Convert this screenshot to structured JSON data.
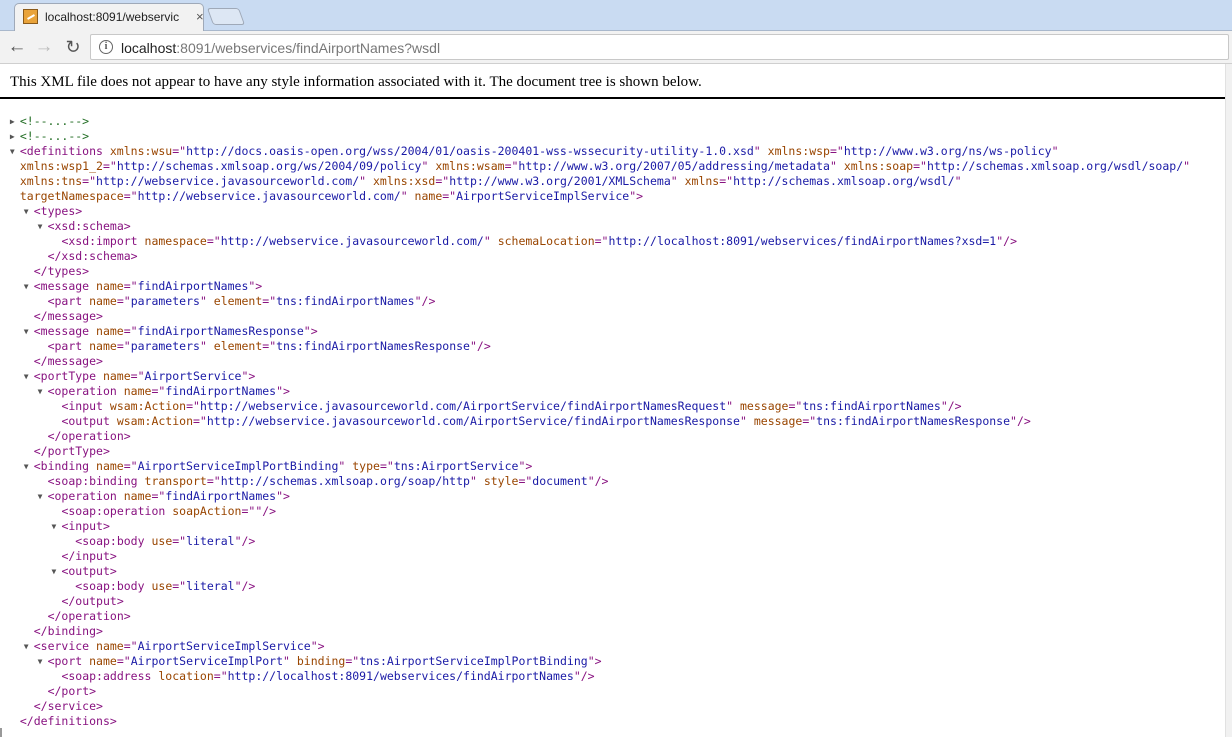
{
  "tab": {
    "title": "localhost:8091/webservic",
    "close": "×"
  },
  "toolbar": {
    "back": "←",
    "forward": "→",
    "reload": "↻"
  },
  "address": {
    "host": "localhost",
    "path": ":8091/webservices/findAirportNames?wsdl"
  },
  "notice": "This XML file does not appear to have any style information associated with it. The document tree is shown below.",
  "xml": [
    {
      "indent": 2,
      "tri": "right",
      "tokens": [
        {
          "k": "c",
          "t": "<!--...-->"
        }
      ]
    },
    {
      "indent": 2,
      "tri": "right",
      "tokens": [
        {
          "k": "c",
          "t": "<!--...-->"
        }
      ]
    },
    {
      "indent": 2,
      "tri": "down",
      "tokens": [
        {
          "k": "t",
          "t": "<definitions"
        },
        {
          "k": "a",
          "t": " xmlns:wsu"
        },
        {
          "k": "t",
          "t": "=\""
        },
        {
          "k": "v",
          "t": "http://docs.oasis-open.org/wss/2004/01/oasis-200401-wss-wssecurity-utility-1.0.xsd"
        },
        {
          "k": "t",
          "t": "\""
        },
        {
          "k": "a",
          "t": " xmlns:wsp"
        },
        {
          "k": "t",
          "t": "=\""
        },
        {
          "k": "v",
          "t": "http://www.w3.org/ns/ws-policy"
        },
        {
          "k": "t",
          "t": "\""
        }
      ]
    },
    {
      "indent": 2,
      "tokens": [
        {
          "k": "a",
          "t": "xmlns:wsp1_2"
        },
        {
          "k": "t",
          "t": "=\""
        },
        {
          "k": "v",
          "t": "http://schemas.xmlsoap.org/ws/2004/09/policy"
        },
        {
          "k": "t",
          "t": "\""
        },
        {
          "k": "a",
          "t": " xmlns:wsam"
        },
        {
          "k": "t",
          "t": "=\""
        },
        {
          "k": "v",
          "t": "http://www.w3.org/2007/05/addressing/metadata"
        },
        {
          "k": "t",
          "t": "\""
        },
        {
          "k": "a",
          "t": " xmlns:soap"
        },
        {
          "k": "t",
          "t": "=\""
        },
        {
          "k": "v",
          "t": "http://schemas.xmlsoap.org/wsdl/soap/"
        },
        {
          "k": "t",
          "t": "\""
        }
      ]
    },
    {
      "indent": 2,
      "tokens": [
        {
          "k": "a",
          "t": "xmlns:tns"
        },
        {
          "k": "t",
          "t": "=\""
        },
        {
          "k": "v",
          "t": "http://webservice.javasourceworld.com/"
        },
        {
          "k": "t",
          "t": "\""
        },
        {
          "k": "a",
          "t": " xmlns:xsd"
        },
        {
          "k": "t",
          "t": "=\""
        },
        {
          "k": "v",
          "t": "http://www.w3.org/2001/XMLSchema"
        },
        {
          "k": "t",
          "t": "\""
        },
        {
          "k": "a",
          "t": " xmlns"
        },
        {
          "k": "t",
          "t": "=\""
        },
        {
          "k": "v",
          "t": "http://schemas.xmlsoap.org/wsdl/"
        },
        {
          "k": "t",
          "t": "\""
        }
      ]
    },
    {
      "indent": 2,
      "tokens": [
        {
          "k": "a",
          "t": "targetNamespace"
        },
        {
          "k": "t",
          "t": "=\""
        },
        {
          "k": "v",
          "t": "http://webservice.javasourceworld.com/"
        },
        {
          "k": "t",
          "t": "\""
        },
        {
          "k": "a",
          "t": " name"
        },
        {
          "k": "t",
          "t": "=\""
        },
        {
          "k": "v",
          "t": "AirportServiceImplService"
        },
        {
          "k": "t",
          "t": "\">"
        }
      ]
    },
    {
      "indent": 4,
      "tri": "down",
      "tokens": [
        {
          "k": "t",
          "t": "<types>"
        }
      ]
    },
    {
      "indent": 6,
      "tri": "down",
      "tokens": [
        {
          "k": "t",
          "t": "<xsd:schema>"
        }
      ]
    },
    {
      "indent": 8,
      "tokens": [
        {
          "k": "t",
          "t": "<xsd:import"
        },
        {
          "k": "a",
          "t": " namespace"
        },
        {
          "k": "t",
          "t": "=\""
        },
        {
          "k": "v",
          "t": "http://webservice.javasourceworld.com/"
        },
        {
          "k": "t",
          "t": "\""
        },
        {
          "k": "a",
          "t": " schemaLocation"
        },
        {
          "k": "t",
          "t": "=\""
        },
        {
          "k": "v",
          "t": "http://localhost:8091/webservices/findAirportNames?xsd=1"
        },
        {
          "k": "t",
          "t": "\"/>"
        }
      ]
    },
    {
      "indent": 6,
      "tokens": [
        {
          "k": "t",
          "t": "</xsd:schema>"
        }
      ]
    },
    {
      "indent": 4,
      "tokens": [
        {
          "k": "t",
          "t": "</types>"
        }
      ]
    },
    {
      "indent": 4,
      "tri": "down",
      "tokens": [
        {
          "k": "t",
          "t": "<message"
        },
        {
          "k": "a",
          "t": " name"
        },
        {
          "k": "t",
          "t": "=\""
        },
        {
          "k": "v",
          "t": "findAirportNames"
        },
        {
          "k": "t",
          "t": "\">"
        }
      ]
    },
    {
      "indent": 6,
      "tokens": [
        {
          "k": "t",
          "t": "<part"
        },
        {
          "k": "a",
          "t": " name"
        },
        {
          "k": "t",
          "t": "=\""
        },
        {
          "k": "v",
          "t": "parameters"
        },
        {
          "k": "t",
          "t": "\""
        },
        {
          "k": "a",
          "t": " element"
        },
        {
          "k": "t",
          "t": "=\""
        },
        {
          "k": "v",
          "t": "tns:findAirportNames"
        },
        {
          "k": "t",
          "t": "\"/>"
        }
      ]
    },
    {
      "indent": 4,
      "tokens": [
        {
          "k": "t",
          "t": "</message>"
        }
      ]
    },
    {
      "indent": 4,
      "tri": "down",
      "tokens": [
        {
          "k": "t",
          "t": "<message"
        },
        {
          "k": "a",
          "t": " name"
        },
        {
          "k": "t",
          "t": "=\""
        },
        {
          "k": "v",
          "t": "findAirportNamesResponse"
        },
        {
          "k": "t",
          "t": "\">"
        }
      ]
    },
    {
      "indent": 6,
      "tokens": [
        {
          "k": "t",
          "t": "<part"
        },
        {
          "k": "a",
          "t": " name"
        },
        {
          "k": "t",
          "t": "=\""
        },
        {
          "k": "v",
          "t": "parameters"
        },
        {
          "k": "t",
          "t": "\""
        },
        {
          "k": "a",
          "t": " element"
        },
        {
          "k": "t",
          "t": "=\""
        },
        {
          "k": "v",
          "t": "tns:findAirportNamesResponse"
        },
        {
          "k": "t",
          "t": "\"/>"
        }
      ]
    },
    {
      "indent": 4,
      "tokens": [
        {
          "k": "t",
          "t": "</message>"
        }
      ]
    },
    {
      "indent": 4,
      "tri": "down",
      "tokens": [
        {
          "k": "t",
          "t": "<portType"
        },
        {
          "k": "a",
          "t": " name"
        },
        {
          "k": "t",
          "t": "=\""
        },
        {
          "k": "v",
          "t": "AirportService"
        },
        {
          "k": "t",
          "t": "\">"
        }
      ]
    },
    {
      "indent": 6,
      "tri": "down",
      "tokens": [
        {
          "k": "t",
          "t": "<operation"
        },
        {
          "k": "a",
          "t": " name"
        },
        {
          "k": "t",
          "t": "=\""
        },
        {
          "k": "v",
          "t": "findAirportNames"
        },
        {
          "k": "t",
          "t": "\">"
        }
      ]
    },
    {
      "indent": 8,
      "tokens": [
        {
          "k": "t",
          "t": "<input"
        },
        {
          "k": "a",
          "t": " wsam:Action"
        },
        {
          "k": "t",
          "t": "=\""
        },
        {
          "k": "v",
          "t": "http://webservice.javasourceworld.com/AirportService/findAirportNamesRequest"
        },
        {
          "k": "t",
          "t": "\""
        },
        {
          "k": "a",
          "t": " message"
        },
        {
          "k": "t",
          "t": "=\""
        },
        {
          "k": "v",
          "t": "tns:findAirportNames"
        },
        {
          "k": "t",
          "t": "\"/>"
        }
      ]
    },
    {
      "indent": 8,
      "tokens": [
        {
          "k": "t",
          "t": "<output"
        },
        {
          "k": "a",
          "t": " wsam:Action"
        },
        {
          "k": "t",
          "t": "=\""
        },
        {
          "k": "v",
          "t": "http://webservice.javasourceworld.com/AirportService/findAirportNamesResponse"
        },
        {
          "k": "t",
          "t": "\""
        },
        {
          "k": "a",
          "t": " message"
        },
        {
          "k": "t",
          "t": "=\""
        },
        {
          "k": "v",
          "t": "tns:findAirportNamesResponse"
        },
        {
          "k": "t",
          "t": "\"/>"
        }
      ]
    },
    {
      "indent": 6,
      "tokens": [
        {
          "k": "t",
          "t": "</operation>"
        }
      ]
    },
    {
      "indent": 4,
      "tokens": [
        {
          "k": "t",
          "t": "</portType>"
        }
      ]
    },
    {
      "indent": 4,
      "tri": "down",
      "tokens": [
        {
          "k": "t",
          "t": "<binding"
        },
        {
          "k": "a",
          "t": " name"
        },
        {
          "k": "t",
          "t": "=\""
        },
        {
          "k": "v",
          "t": "AirportServiceImplPortBinding"
        },
        {
          "k": "t",
          "t": "\""
        },
        {
          "k": "a",
          "t": " type"
        },
        {
          "k": "t",
          "t": "=\""
        },
        {
          "k": "v",
          "t": "tns:AirportService"
        },
        {
          "k": "t",
          "t": "\">"
        }
      ]
    },
    {
      "indent": 6,
      "tokens": [
        {
          "k": "t",
          "t": "<soap:binding"
        },
        {
          "k": "a",
          "t": " transport"
        },
        {
          "k": "t",
          "t": "=\""
        },
        {
          "k": "v",
          "t": "http://schemas.xmlsoap.org/soap/http"
        },
        {
          "k": "t",
          "t": "\""
        },
        {
          "k": "a",
          "t": " style"
        },
        {
          "k": "t",
          "t": "=\""
        },
        {
          "k": "v",
          "t": "document"
        },
        {
          "k": "t",
          "t": "\"/>"
        }
      ]
    },
    {
      "indent": 6,
      "tri": "down",
      "tokens": [
        {
          "k": "t",
          "t": "<operation"
        },
        {
          "k": "a",
          "t": " name"
        },
        {
          "k": "t",
          "t": "=\""
        },
        {
          "k": "v",
          "t": "findAirportNames"
        },
        {
          "k": "t",
          "t": "\">"
        }
      ]
    },
    {
      "indent": 8,
      "tokens": [
        {
          "k": "t",
          "t": "<soap:operation"
        },
        {
          "k": "a",
          "t": " soapAction"
        },
        {
          "k": "t",
          "t": "=\"\"/>"
        }
      ]
    },
    {
      "indent": 8,
      "tri": "down",
      "tokens": [
        {
          "k": "t",
          "t": "<input>"
        }
      ]
    },
    {
      "indent": 10,
      "tokens": [
        {
          "k": "t",
          "t": "<soap:body"
        },
        {
          "k": "a",
          "t": " use"
        },
        {
          "k": "t",
          "t": "=\""
        },
        {
          "k": "v",
          "t": "literal"
        },
        {
          "k": "t",
          "t": "\"/>"
        }
      ]
    },
    {
      "indent": 8,
      "tokens": [
        {
          "k": "t",
          "t": "</input>"
        }
      ]
    },
    {
      "indent": 8,
      "tri": "down",
      "tokens": [
        {
          "k": "t",
          "t": "<output>"
        }
      ]
    },
    {
      "indent": 10,
      "tokens": [
        {
          "k": "t",
          "t": "<soap:body"
        },
        {
          "k": "a",
          "t": " use"
        },
        {
          "k": "t",
          "t": "=\""
        },
        {
          "k": "v",
          "t": "literal"
        },
        {
          "k": "t",
          "t": "\"/>"
        }
      ]
    },
    {
      "indent": 8,
      "tokens": [
        {
          "k": "t",
          "t": "</output>"
        }
      ]
    },
    {
      "indent": 6,
      "tokens": [
        {
          "k": "t",
          "t": "</operation>"
        }
      ]
    },
    {
      "indent": 4,
      "tokens": [
        {
          "k": "t",
          "t": "</binding>"
        }
      ]
    },
    {
      "indent": 4,
      "tri": "down",
      "tokens": [
        {
          "k": "t",
          "t": "<service"
        },
        {
          "k": "a",
          "t": " name"
        },
        {
          "k": "t",
          "t": "=\""
        },
        {
          "k": "v",
          "t": "AirportServiceImplService"
        },
        {
          "k": "t",
          "t": "\">"
        }
      ]
    },
    {
      "indent": 6,
      "tri": "down",
      "tokens": [
        {
          "k": "t",
          "t": "<port"
        },
        {
          "k": "a",
          "t": " name"
        },
        {
          "k": "t",
          "t": "=\""
        },
        {
          "k": "v",
          "t": "AirportServiceImplPort"
        },
        {
          "k": "t",
          "t": "\""
        },
        {
          "k": "a",
          "t": " binding"
        },
        {
          "k": "t",
          "t": "=\""
        },
        {
          "k": "v",
          "t": "tns:AirportServiceImplPortBinding"
        },
        {
          "k": "t",
          "t": "\">"
        }
      ]
    },
    {
      "indent": 8,
      "tokens": [
        {
          "k": "t",
          "t": "<soap:address"
        },
        {
          "k": "a",
          "t": " location"
        },
        {
          "k": "t",
          "t": "=\""
        },
        {
          "k": "v",
          "t": "http://localhost:8091/webservices/findAirportNames"
        },
        {
          "k": "t",
          "t": "\"/>"
        }
      ]
    },
    {
      "indent": 6,
      "tokens": [
        {
          "k": "t",
          "t": "</port>"
        }
      ]
    },
    {
      "indent": 4,
      "tokens": [
        {
          "k": "t",
          "t": "</service>"
        }
      ]
    },
    {
      "indent": 2,
      "tokens": [
        {
          "k": "t",
          "t": "</definitions>"
        }
      ]
    }
  ]
}
